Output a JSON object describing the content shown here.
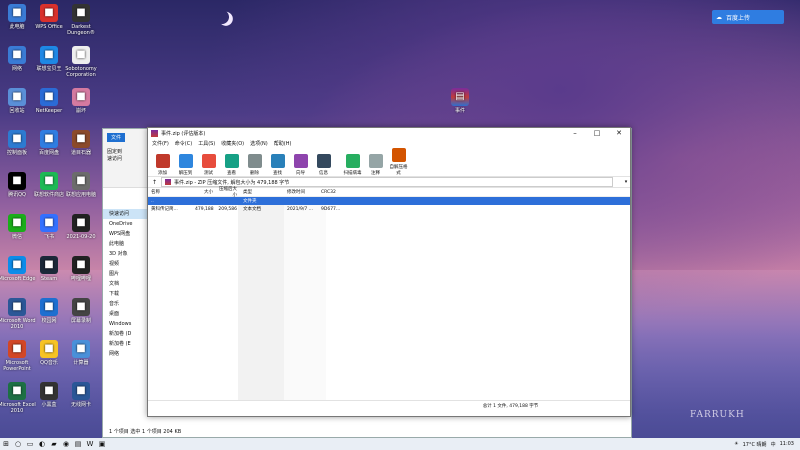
{
  "desktop": {
    "icons": [
      {
        "label": "此电脑",
        "icon": "computer-icon",
        "color": "#3a7bd5"
      },
      {
        "label": "WPS Office",
        "icon": "wps-icon",
        "color": "#d9312c"
      },
      {
        "label": "Darkest Dungeon®",
        "icon": "game-icon",
        "color": "#333333"
      },
      {
        "label": "网络",
        "icon": "network-icon",
        "color": "#3a7bd5"
      },
      {
        "label": "联想宝贝王",
        "icon": "lenovo-icon",
        "color": "#1e88e5"
      },
      {
        "label": "Sobotonomy Corporation",
        "icon": "document-icon",
        "color": "#eeeeee"
      },
      {
        "label": "回收站",
        "icon": "recycle-icon",
        "color": "#5a8fd8"
      },
      {
        "label": "NetKeeper",
        "icon": "netkeeper-icon",
        "color": "#2b6bd6"
      },
      {
        "label": "崩坏",
        "icon": "game-icon",
        "color": "#d47aa0"
      },
      {
        "label": "控制面板",
        "icon": "control-panel-icon",
        "color": "#2d7bd1"
      },
      {
        "label": "百度网盘",
        "icon": "cloud-icon",
        "color": "#2f7de1"
      },
      {
        "label": "道目石器",
        "icon": "app-icon",
        "color": "#8b4a2b"
      },
      {
        "label": "腾讯QQ",
        "icon": "qq-icon",
        "color": "#000000"
      },
      {
        "label": "联想软件商店",
        "icon": "store-icon",
        "color": "#1db954"
      },
      {
        "label": "联想应用电脑",
        "icon": "app-icon",
        "color": "#6c6c6c"
      },
      {
        "label": "微信",
        "icon": "wechat-icon",
        "color": "#1aad19"
      },
      {
        "label": "飞书",
        "icon": "feishu-icon",
        "color": "#3370ff"
      },
      {
        "label": "2021-09-20",
        "icon": "file-icon",
        "color": "#222222"
      },
      {
        "label": "Microsoft Edge",
        "icon": "edge-icon",
        "color": "#0c8ce9"
      },
      {
        "label": "Steam",
        "icon": "steam-icon",
        "color": "#1b2838"
      },
      {
        "label": "哔哩哔哩",
        "icon": "app-icon",
        "color": "#222222"
      },
      {
        "label": "Microsoft Word 2010",
        "icon": "word-icon",
        "color": "#2b5797"
      },
      {
        "label": "校园网",
        "icon": "app-icon",
        "color": "#1e6fd0"
      },
      {
        "label": "屏幕录制",
        "icon": "app-icon",
        "color": "#444444"
      },
      {
        "label": "Microsoft PowerPoint",
        "icon": "ppt-icon",
        "color": "#d24726"
      },
      {
        "label": "QQ音乐",
        "icon": "music-icon",
        "color": "#f6c324"
      },
      {
        "label": "计算器",
        "icon": "doc-icon",
        "color": "#4a90d9"
      },
      {
        "label": "Microsoft Excel 2010",
        "icon": "excel-icon",
        "color": "#1d7044"
      },
      {
        "label": "小黑盒",
        "icon": "app-icon",
        "color": "#333333"
      },
      {
        "label": "无线网卡",
        "icon": "doc-icon",
        "color": "#2b5797"
      }
    ],
    "rar_icon_label": "事件",
    "baidu_button": "百度上传"
  },
  "explorer": {
    "file_tab": "文件",
    "pin_label": "固定到\n速访问",
    "nav": [
      "快速访问",
      "OneDrive",
      "WPS网盘",
      "此电脑",
      "3D 对象",
      "视频",
      "图片",
      "文档",
      "下载",
      "音乐",
      "桌面",
      "Windows",
      "新加卷 (D",
      "新加卷 (E",
      "网络"
    ],
    "status": "1 个项目    选中 1 个项目  204 KB"
  },
  "rar": {
    "title": "事件.zip (评估版本)",
    "menu": [
      "文件(F)",
      "命令(C)",
      "工具(S)",
      "收藏夹(O)",
      "选项(N)",
      "帮助(H)"
    ],
    "tools": [
      {
        "label": "添加",
        "icon": "add-icon",
        "color": "#c0392b"
      },
      {
        "label": "解压到",
        "icon": "extract-icon",
        "color": "#2e86de"
      },
      {
        "label": "测试",
        "icon": "test-icon",
        "color": "#e74c3c"
      },
      {
        "label": "查看",
        "icon": "view-icon",
        "color": "#16a085"
      },
      {
        "label": "删除",
        "icon": "delete-icon",
        "color": "#7f8c8d"
      },
      {
        "label": "查找",
        "icon": "find-icon",
        "color": "#2980b9"
      },
      {
        "label": "向导",
        "icon": "wizard-icon",
        "color": "#8e44ad"
      },
      {
        "label": "信息",
        "icon": "info-icon",
        "color": "#34495e"
      },
      {
        "label": "扫描病毒",
        "icon": "scan-icon",
        "color": "#27ae60"
      },
      {
        "label": "注释",
        "icon": "comment-icon",
        "color": "#95a5a6"
      },
      {
        "label": "自解压格式",
        "icon": "sfx-icon",
        "color": "#d35400"
      }
    ],
    "address": "事件.zip - ZIP 压缩文件, 解包大小为 479,188 字节",
    "columns": {
      "name": "名称",
      "size": "大小",
      "packed": "压缩后大小",
      "type": "类型",
      "modified": "修改时间",
      "crc": "CRC32"
    },
    "rows": [
      {
        "name": "..",
        "size": "",
        "packed": "",
        "type": "文件夹",
        "modified": "",
        "crc": "",
        "selected": true
      },
      {
        "name": "黄科传记简...",
        "size": "479,188",
        "packed": "209,586",
        "type": "文本文档",
        "modified": "2021/9/7 ...",
        "crc": "9D677...",
        "selected": false
      }
    ],
    "status_left": "",
    "status_right": "总计 1 文件, 479,188 字节"
  },
  "taskbar": {
    "temp": "17°C 晴朗",
    "ime": "中",
    "time": "11:03",
    "icons": [
      "start-icon",
      "search-icon",
      "taskview-icon",
      "edge-icon",
      "folder-icon",
      "chrome-icon",
      "winrar-icon",
      "wps-icon",
      "store-icon"
    ]
  },
  "watermark": "FARRUKH"
}
